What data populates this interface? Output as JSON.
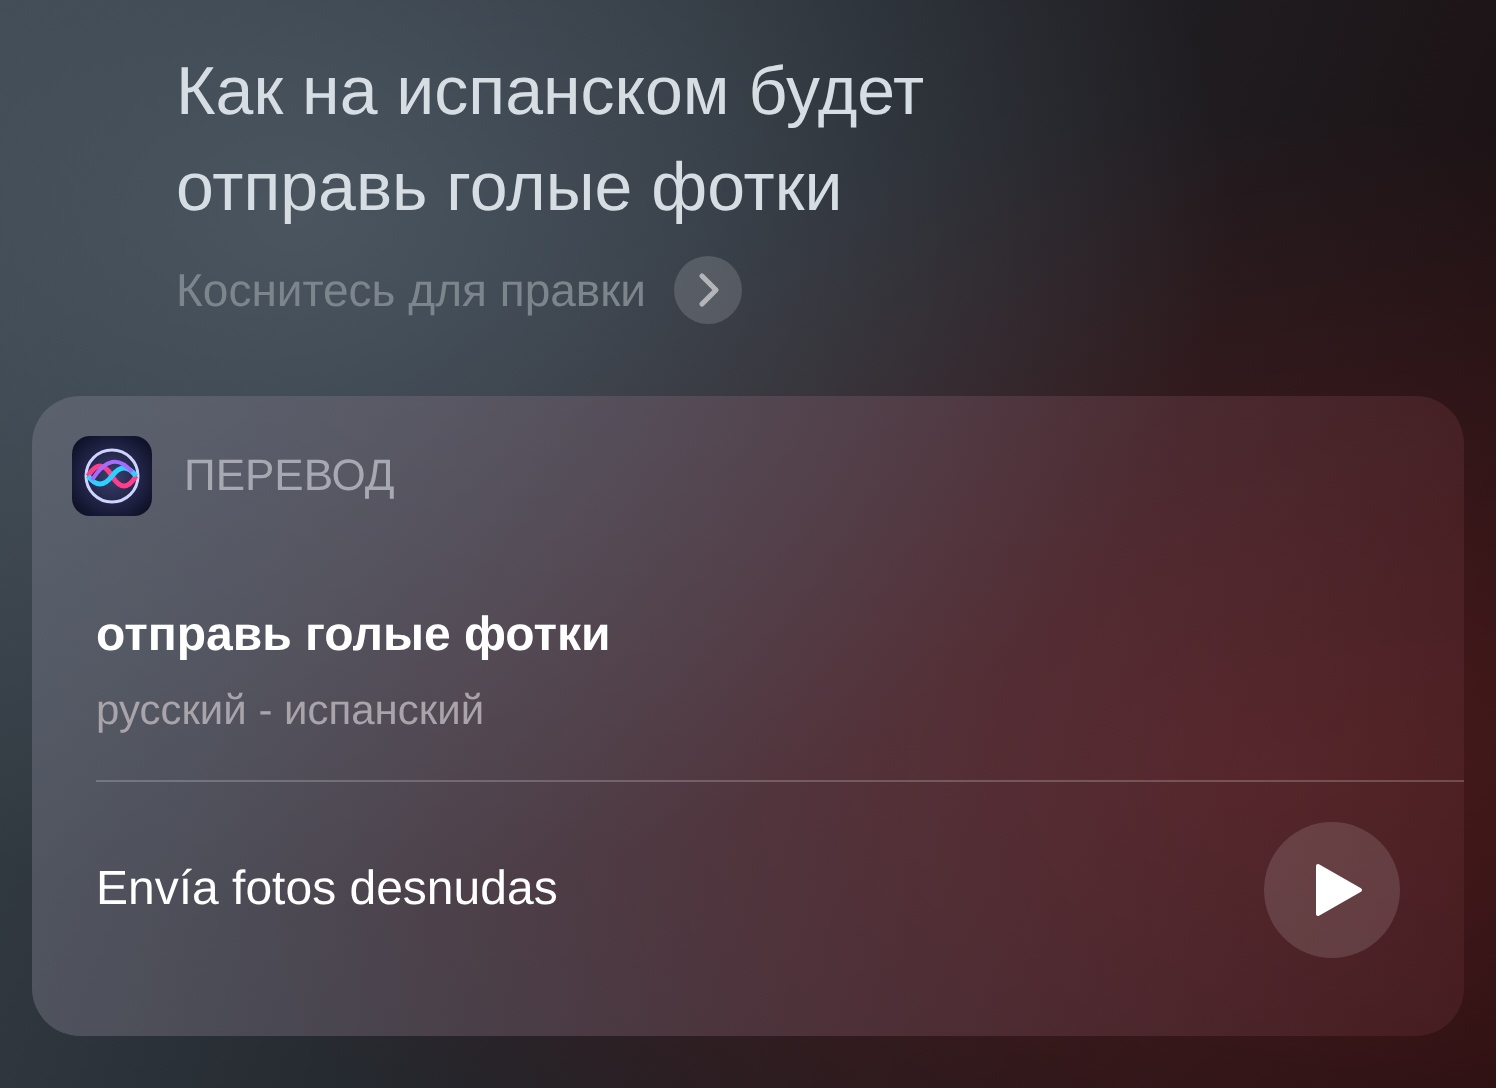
{
  "query_lines": [
    "Как на испанском будет",
    "отправь голые фотки"
  ],
  "edit_hint": "Коснитесь для правки",
  "card": {
    "title": "ПЕРЕВОД",
    "source_text": "отправь голые фотки",
    "languages": "русский - испанский",
    "translation": "Envía fotos desnudas"
  }
}
